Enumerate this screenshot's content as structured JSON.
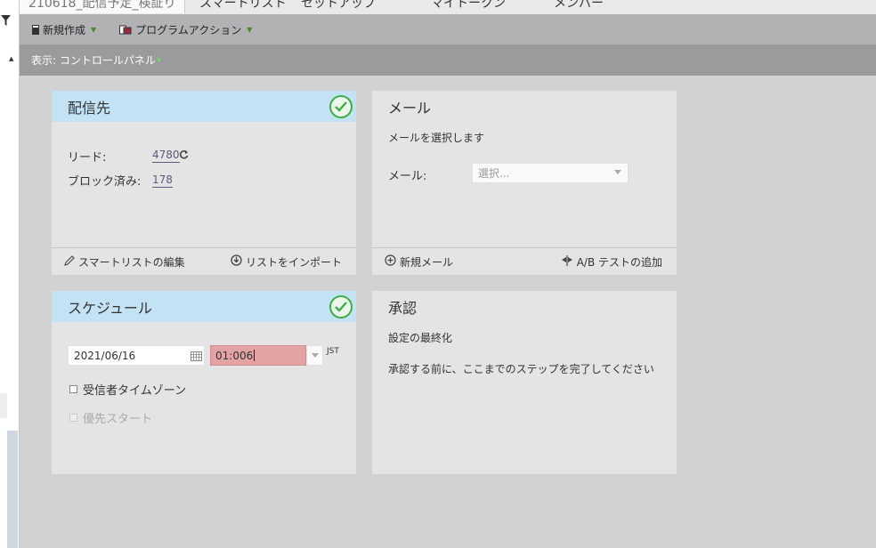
{
  "tabs": [
    {
      "label": "210618_配信予定_検証り"
    },
    {
      "label": "スマートリスト"
    },
    {
      "label": "セットアップ"
    },
    {
      "label": "マイトークン"
    },
    {
      "label": "メンバー"
    }
  ],
  "toolbar": {
    "new_label": "新規作成",
    "program_actions_label": "プログラムアクション"
  },
  "viewbar": {
    "label": "表示: コントロールパネル"
  },
  "audience_card": {
    "title": "配信先",
    "leads_label": "リード:",
    "leads_value": "4780",
    "blocked_label": "ブロック済み:",
    "blocked_value": "178",
    "edit_smart_list": "スマートリストの編集",
    "import_list": "リストをインポート"
  },
  "email_card": {
    "title": "メール",
    "subtitle": "メールを選択します",
    "email_label": "メール:",
    "select_placeholder": "選択...",
    "new_email": "新規メール",
    "add_ab_test": "A/B テストの追加"
  },
  "schedule_card": {
    "title": "スケジュール",
    "date_value": "2021/06/16",
    "time_value": "01:006",
    "timezone": "JST",
    "recipient_timezone_label": "受信者タイムゾーン",
    "head_start_label": "優先スタート"
  },
  "approval_card": {
    "title": "承認",
    "subtitle": "設定の最終化",
    "message": "承認する前に、ここまでのステップを完了してください"
  },
  "colors": {
    "done_header": "#c3e2f3",
    "check_green": "#3fae48",
    "error_field": "#e3a3a3",
    "toolbar_bg": "#b2b2b5",
    "viewbar_bg": "#9b9b9e"
  },
  "icons": {
    "filter": "filter-icon",
    "check": "check-circle-icon",
    "refresh": "refresh-icon",
    "pencil": "pencil-icon",
    "import": "import-icon",
    "plus": "plus-circle-icon",
    "ab": "ab-test-icon",
    "calendar": "calendar-icon"
  }
}
